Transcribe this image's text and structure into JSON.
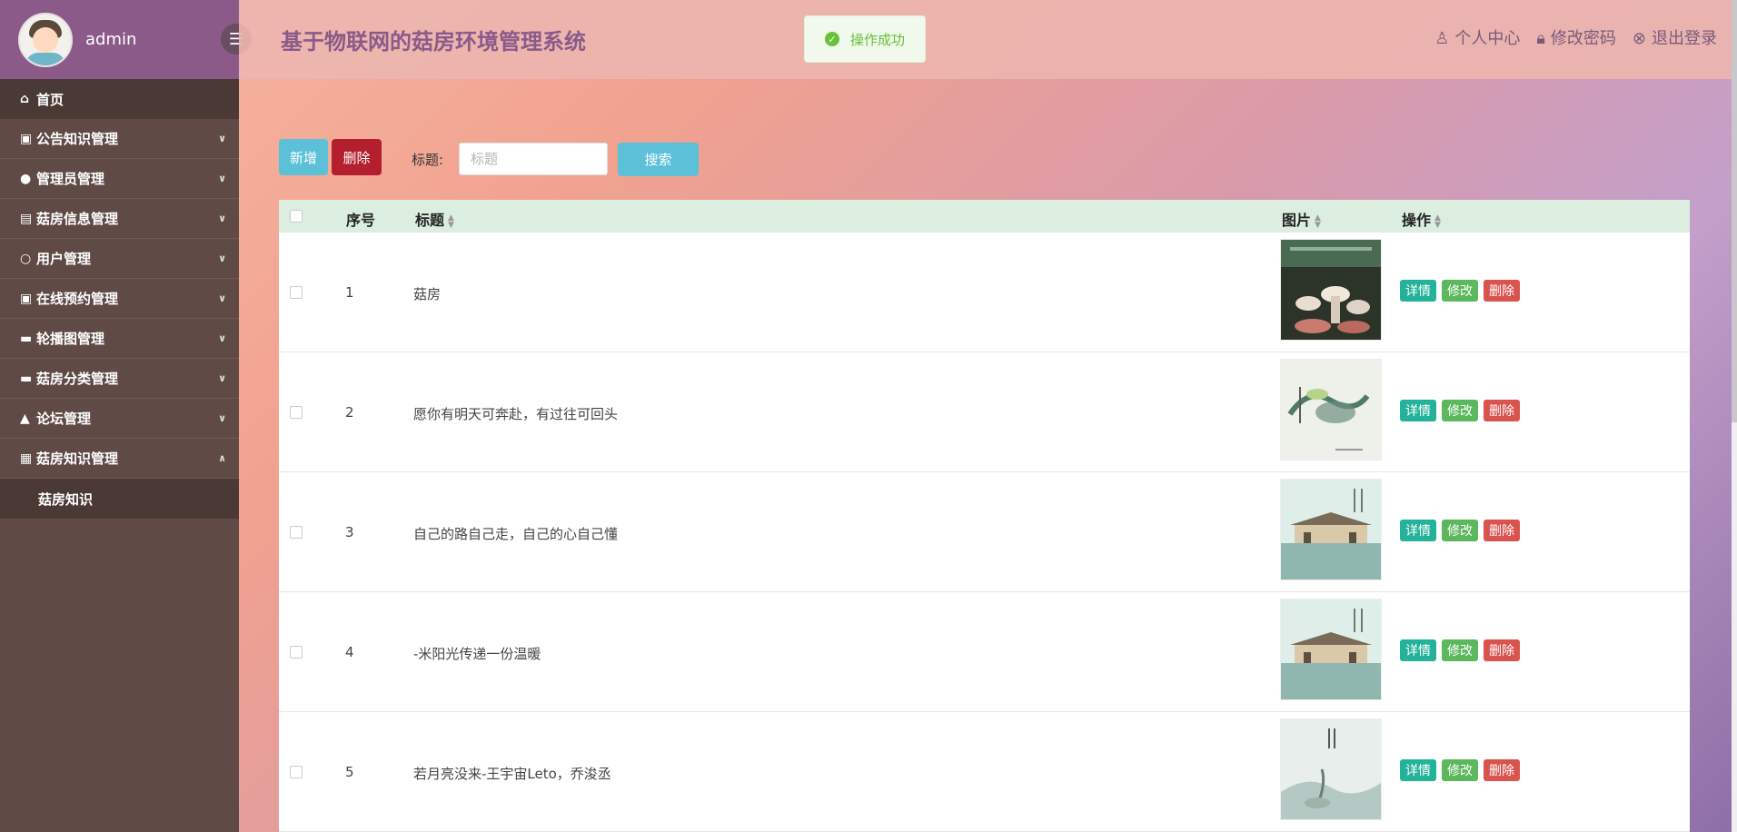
{
  "sidebar": {
    "username": "admin",
    "home": "首页",
    "items": [
      {
        "label": "公告知识管理",
        "icon": "briefcase-icon"
      },
      {
        "label": "管理员管理",
        "icon": "user-icon"
      },
      {
        "label": "菇房信息管理",
        "icon": "print-icon"
      },
      {
        "label": "用户管理",
        "icon": "user-outline-icon"
      },
      {
        "label": "在线预约管理",
        "icon": "briefcase-icon"
      },
      {
        "label": "轮播图管理",
        "icon": "picture-icon"
      },
      {
        "label": "菇房分类管理",
        "icon": "picture-icon"
      },
      {
        "label": "论坛管理",
        "icon": "bell-icon"
      },
      {
        "label": "菇房知识管理",
        "icon": "grid-icon"
      }
    ],
    "sub_item": "菇房知识"
  },
  "header": {
    "title": "基于物联网的菇房环境管理系统",
    "toast": "操作成功",
    "links": {
      "personal": "个人中心",
      "password": "修改密码",
      "logout": "退出登录"
    }
  },
  "toolbar": {
    "add_label": "新增",
    "delete_label": "删除",
    "search_label": "标题:",
    "search_placeholder": "标题",
    "search_button": "搜索"
  },
  "table": {
    "headers": {
      "index": "序号",
      "title": "标题",
      "image": "图片",
      "action": "操作"
    },
    "actions": {
      "detail": "详情",
      "edit": "修改",
      "delete": "删除"
    },
    "rows": [
      {
        "index": "1",
        "title": "菇房"
      },
      {
        "index": "2",
        "title": "愿你有明天可奔赴，有过往可回头"
      },
      {
        "index": "3",
        "title": "自己的路自己走，自己的心自己懂"
      },
      {
        "index": "4",
        "title": "-米阳光传递一份温暖"
      },
      {
        "index": "5",
        "title": "若月亮没来-王宇宙Leto，乔浚丞"
      }
    ]
  },
  "colors": {
    "sidebar": "#5f4a46",
    "profile": "#8b5a88",
    "table_header": "#dbeee0",
    "detail": "#24b29a",
    "edit": "#5cb85c",
    "delete": "#d9534f"
  }
}
